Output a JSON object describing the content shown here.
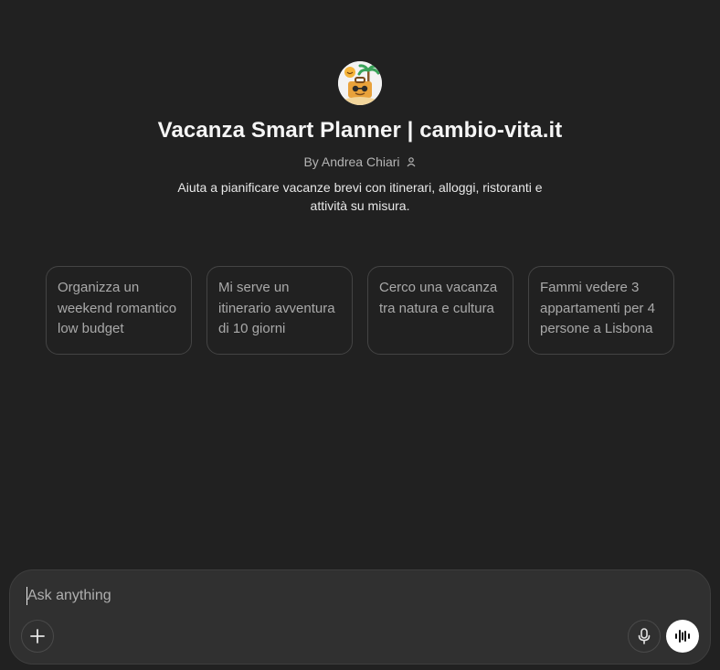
{
  "gpt": {
    "avatar_icon": "vacation-emoji-icon",
    "title": "Vacanza Smart Planner | cambio-vita.it",
    "byline": "By Andrea Chiari",
    "description": "Aiuta a pianificare vacanze brevi con itinerari, alloggi, ristoranti e attività su misura."
  },
  "starters": [
    {
      "label": "Organizza un weekend romantico low budget"
    },
    {
      "label": "Mi serve un itinerario avventura di 10 giorni"
    },
    {
      "label": "Cerco una vacanza tra natura e cultura"
    },
    {
      "label": "Fammi vedere 3 appartamenti per 4 persone a Lisbona"
    }
  ],
  "composer": {
    "placeholder": "Ask anything",
    "value": "",
    "icons": {
      "attach": "plus-icon",
      "mic": "microphone-icon",
      "voice": "voice-mode-icon"
    }
  },
  "colors": {
    "background": "#212121",
    "composer": "#303030",
    "card_border": "#444444"
  }
}
